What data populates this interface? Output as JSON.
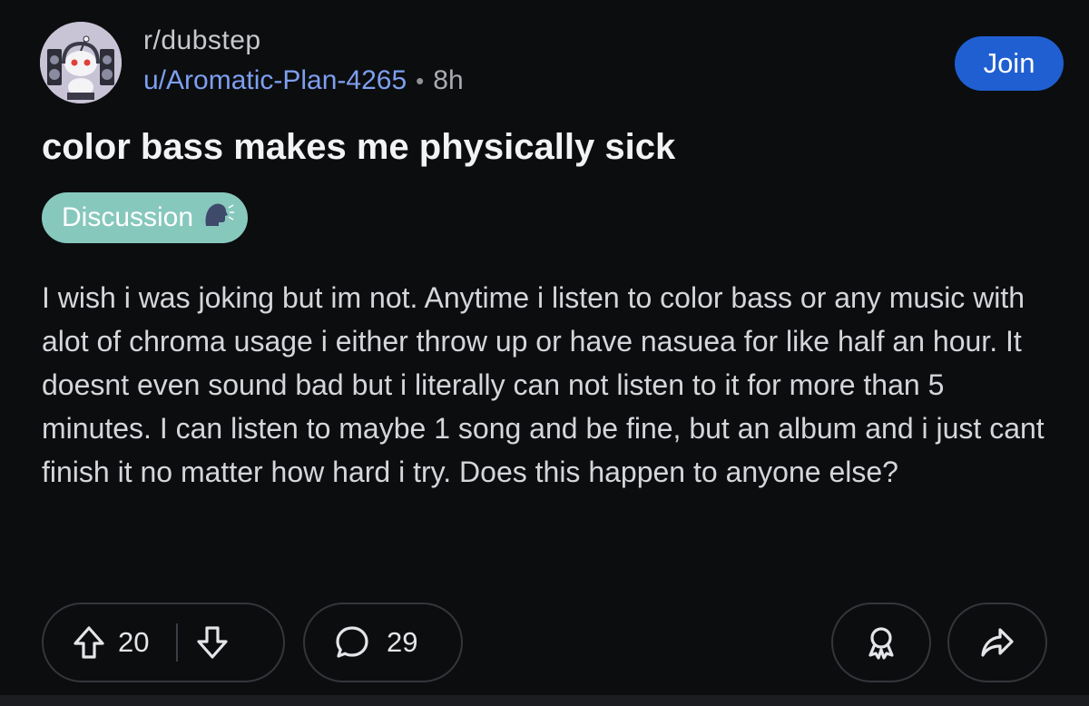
{
  "post": {
    "community": "r/dubstep",
    "author": "u/Aromatic-Plan-4265",
    "separator": "•",
    "age": "8h",
    "join_label": "Join",
    "title": "color bass makes me physically sick",
    "flair": {
      "label": "Discussion",
      "emoji": "🗣️",
      "color": "#87c8bd"
    },
    "body": "I wish i was joking but im not. Anytime i listen to color bass or any music with alot of chroma usage i either throw up or have nasuea for like half an hour. It doesnt even sound bad but i literally can not listen to it for more than 5 minutes. I can listen to maybe 1 song and be fine, but an album and i just cant finish it no matter how hard i try. Does this happen to anyone else?"
  },
  "actions": {
    "upvotes": "20",
    "comments": "29",
    "icons": [
      "upvote-icon",
      "downvote-icon",
      "comment-icon",
      "award-icon",
      "share-icon"
    ]
  },
  "colors": {
    "background": "#0c0d0f",
    "join_button": "#1f5fd1",
    "author_link": "#7e9ff0"
  }
}
